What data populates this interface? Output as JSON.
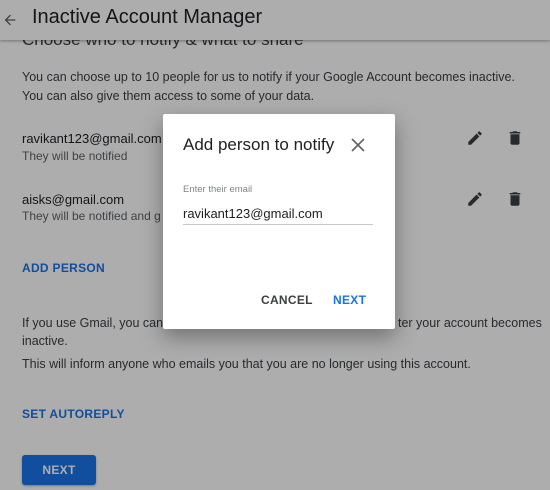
{
  "app": {
    "title": "Inactive Account Manager"
  },
  "page": {
    "section_heading": "Choose who to notify & what to share",
    "intro": "You can choose up to 10 people for us to notify if your Google Account becomes inactive. You can also give them access to some of your data.",
    "contacts": [
      {
        "email": "ravikant123@gmail.com",
        "status": "They will be notified"
      },
      {
        "email": "aisks@gmail.com",
        "status": "They will be notified and g"
      }
    ],
    "add_person_label": "ADD PERSON",
    "gmail_note": "If you use Gmail, you can a                                                              ter your account becomes inactive.",
    "gmail_note_parts": {
      "left": "If you use Gmail, you can a",
      "right": "ter your account becomes",
      "line2": "inactive."
    },
    "autoreply_note": "This will inform anyone who emails you that you are no longer using this account.",
    "set_autoreply_label": "SET AUTOREPLY",
    "next_label": "NEXT"
  },
  "dialog": {
    "title": "Add person to notify",
    "email_label": "Enter their email",
    "email_value": "ravikant123@gmail.com",
    "cancel_label": "CANCEL",
    "next_label": "NEXT"
  },
  "icons": {
    "back": "arrow-back-icon",
    "edit": "pencil-icon",
    "delete": "trash-icon",
    "close": "close-icon"
  },
  "colors": {
    "accent": "#1a73e8",
    "scrim": "rgba(0,0,0,0.32)"
  }
}
